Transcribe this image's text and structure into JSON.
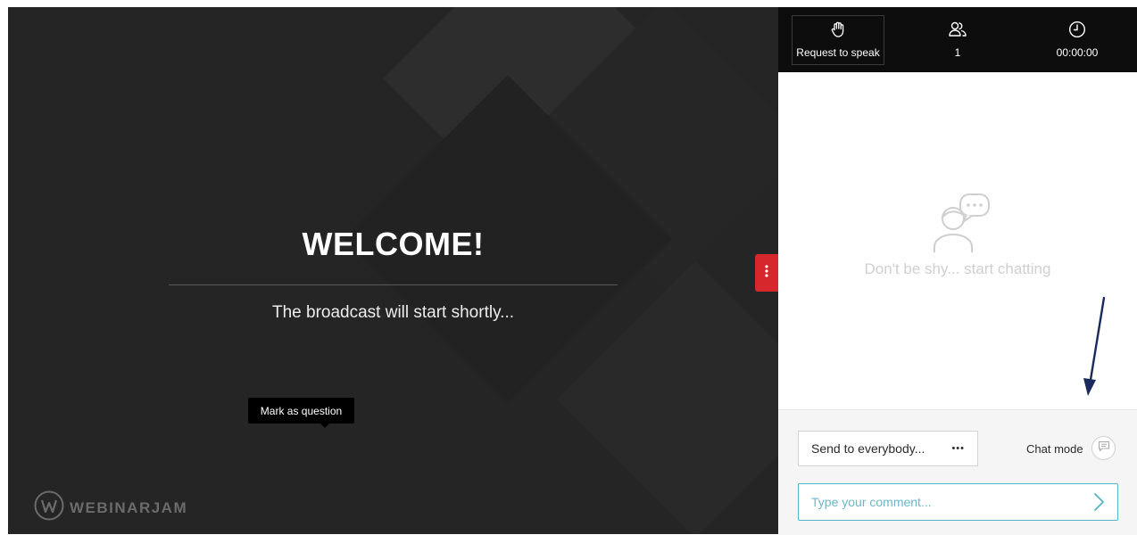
{
  "stage": {
    "title": "WELCOME!",
    "subtitle": "The broadcast will start shortly...",
    "brand": "WEBINARJAM"
  },
  "topbar": {
    "request_label": "Request to speak",
    "attendees_count": "1",
    "timer": "00:00:00"
  },
  "chat": {
    "empty_text": "Don't be shy... start chatting",
    "send_to_label": "Send to everybody...",
    "more_label": "•••",
    "chat_mode_label": "Chat mode",
    "tooltip": "Mark as question",
    "comment_placeholder": "Type your comment..."
  },
  "colors": {
    "stage_bg": "#252525",
    "accent_red": "#d6272c",
    "input_border": "#54b5c9",
    "annotation_arrow": "#1b2a5e"
  },
  "icons": [
    "hand-raise-icon",
    "users-icon",
    "clock-icon",
    "chat-person-icon",
    "dots-vertical-icon",
    "message-square-icon",
    "chevron-right-icon",
    "webinarjam-logo-icon"
  ]
}
